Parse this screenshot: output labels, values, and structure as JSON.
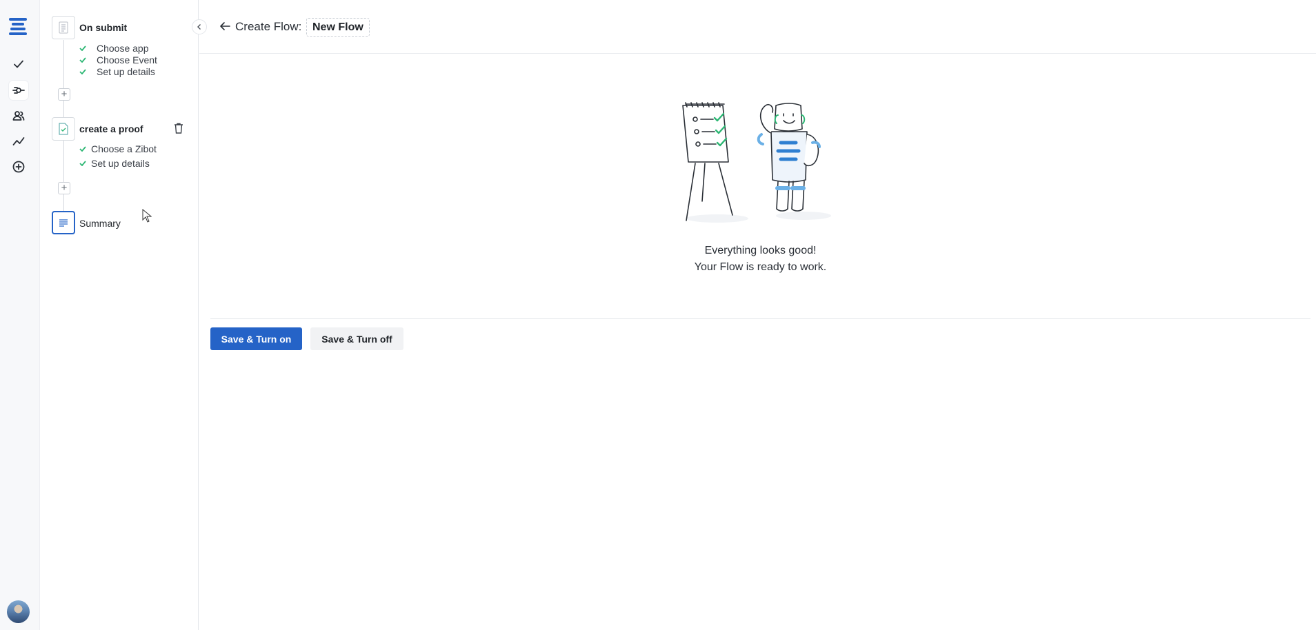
{
  "rail": {
    "nav": [
      {
        "name": "tasks",
        "icon": "check-icon"
      },
      {
        "name": "flows",
        "icon": "flow-icon",
        "active": true
      },
      {
        "name": "users",
        "icon": "users-icon"
      },
      {
        "name": "analytics",
        "icon": "analytics-icon"
      },
      {
        "name": "add",
        "icon": "plus-circle-icon"
      }
    ],
    "accent": "#2563c7"
  },
  "steps": {
    "trigger": {
      "title": "On submit",
      "items": [
        "Choose app",
        "Choose Event",
        "Set up details"
      ]
    },
    "action": {
      "title": "create a proof",
      "items": [
        "Choose a Zibot",
        "Set up details"
      ]
    },
    "summary": {
      "title": "Summary"
    }
  },
  "header": {
    "label": "Create Flow:",
    "flow_name": "New Flow"
  },
  "main": {
    "message_line1": "Everything looks good!",
    "message_line2": "Your Flow is ready to work.",
    "save_on_label": "Save & Turn on",
    "save_off_label": "Save & Turn off"
  }
}
